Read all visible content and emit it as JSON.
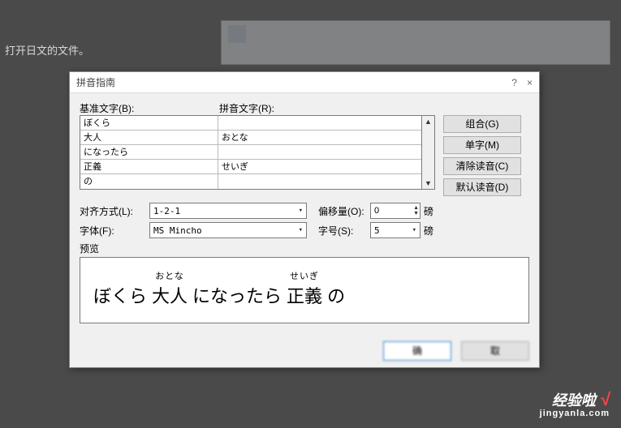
{
  "background": {
    "caption": "打开日文的文件。"
  },
  "dialog": {
    "title": "拼音指南",
    "help_icon": "?",
    "close_icon": "×",
    "labels": {
      "base_text": "基准文字(B):",
      "ruby_text": "拼音文字(R):",
      "alignment": "对齐方式(L):",
      "font": "字体(F):",
      "offset": "偏移量(O):",
      "font_size": "字号(S):",
      "preview": "预览"
    },
    "rows": [
      {
        "base": "ぼくら",
        "ruby": ""
      },
      {
        "base": "大人",
        "ruby": "おとな"
      },
      {
        "base": "になったら",
        "ruby": ""
      },
      {
        "base": "正義",
        "ruby": "せいぎ"
      },
      {
        "base": "の",
        "ruby": ""
      }
    ],
    "alignment_value": "1-2-1",
    "font_value": "MS Mincho",
    "offset_value": "0",
    "offset_unit": "磅",
    "size_value": "5",
    "size_unit": "磅",
    "side_buttons": {
      "combine": "组合(G)",
      "single": "单字(M)",
      "clear": "清除读音(C)",
      "default": "默认读音(D)"
    },
    "footer": {
      "ok": "确",
      "cancel": "取"
    },
    "preview_segments": [
      {
        "base": "ぼくら",
        "ruby": ""
      },
      {
        "base": "大人",
        "ruby": "おとな"
      },
      {
        "base": "になったら",
        "ruby": ""
      },
      {
        "base": "正義",
        "ruby": "せいぎ"
      },
      {
        "base": "の",
        "ruby": ""
      }
    ]
  },
  "watermark": {
    "line1a": "经验啦",
    "line1b": "√",
    "line2": "jingyanla.com",
    "side": ""
  }
}
